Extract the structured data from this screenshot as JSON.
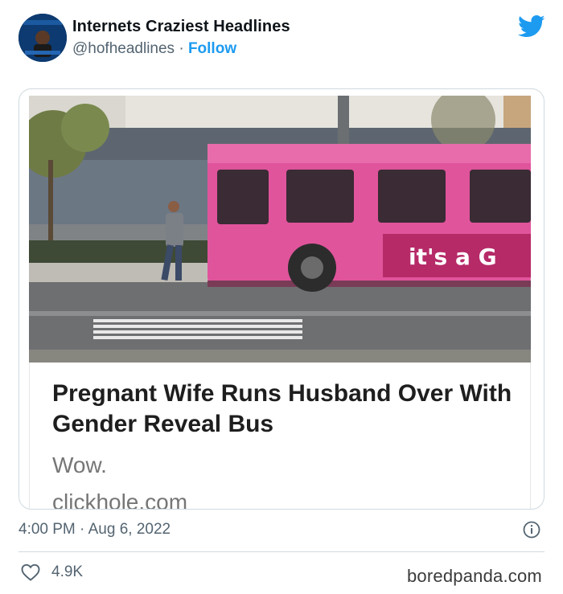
{
  "author": {
    "display_name": "Internets Craziest Headlines",
    "handle": "@hofheadlines",
    "separator": "·",
    "follow_label": "Follow"
  },
  "card": {
    "headline": "Pregnant Wife Runs Husband Over With Gender Reveal Bus",
    "dek": "Wow.",
    "domain": "clickhole.com",
    "bus_text": "it's a G"
  },
  "tweet": {
    "time": "4:00 PM",
    "separator": "·",
    "date": "Aug 6, 2022",
    "likes": "4.9K"
  },
  "watermark": "boredpanda.com",
  "icons": {
    "brand": "twitter-bird-icon",
    "info": "info-icon",
    "like": "heart-icon"
  },
  "colors": {
    "twitter_blue": "#1d9bf0",
    "bus_pink": "#e0549c",
    "text_primary": "#0f1419",
    "text_secondary": "#536471"
  }
}
